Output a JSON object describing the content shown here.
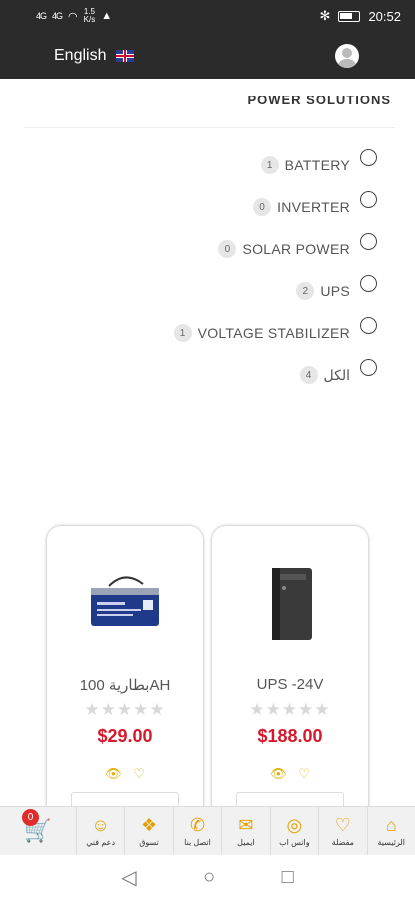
{
  "status_bar": {
    "signal_1": "4G",
    "signal_2": "4G",
    "speed": "1.5",
    "speed_unit": "K/s",
    "time": "20:52"
  },
  "header": {
    "language": "English"
  },
  "filter": {
    "title": "POWER SOLUTIONS",
    "items": [
      {
        "label": "BATTERY",
        "count": "1"
      },
      {
        "label": "INVERTER",
        "count": "0"
      },
      {
        "label": "SOLAR POWER",
        "count": "0"
      },
      {
        "label": "UPS",
        "count": "2"
      },
      {
        "label": "VOLTAGE STABILIZER",
        "count": "1"
      },
      {
        "label": "الكل",
        "count": "4"
      }
    ]
  },
  "products": [
    {
      "name": "بطارية 100AH",
      "price": "$29.00",
      "rating": 0
    },
    {
      "name": "UPS -24V",
      "price": "$188.00",
      "rating": 0
    }
  ],
  "bottom_nav": {
    "cart_count": "0",
    "items": [
      {
        "label": "دعم فني",
        "icon": "support-icon"
      },
      {
        "label": "تسوق",
        "icon": "shop-icon"
      },
      {
        "label": "اتصل بنا",
        "icon": "phone-icon"
      },
      {
        "label": "ايميل",
        "icon": "mail-icon"
      },
      {
        "label": "واتس اب",
        "icon": "whatsapp-icon"
      },
      {
        "label": "مفضلة",
        "icon": "heart-icon"
      },
      {
        "label": "الرئيسية",
        "icon": "home-icon"
      }
    ]
  },
  "colors": {
    "accent": "#e3a008",
    "price": "#d7192b",
    "header_bg": "#2b2b2b"
  }
}
